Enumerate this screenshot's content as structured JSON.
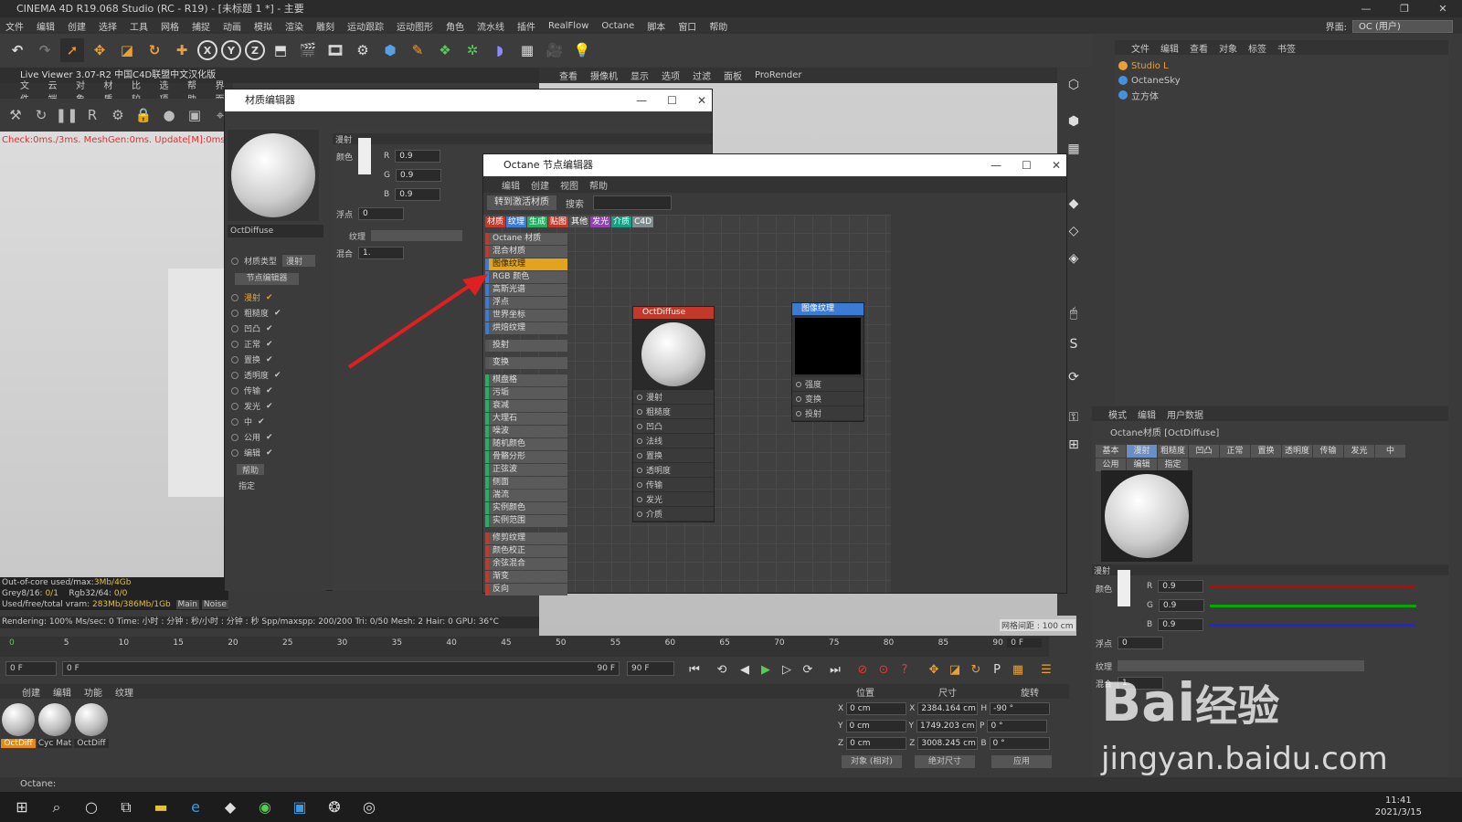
{
  "app": {
    "title": "CINEMA 4D R19.068 Studio (RC - R19) - [未标题 1 *] - 主要",
    "controls": [
      "—",
      "❐",
      "✕"
    ],
    "interface_label": "界面:",
    "interface_value": "OC (用户)"
  },
  "menu": [
    "文件",
    "编辑",
    "创建",
    "选择",
    "工具",
    "网格",
    "捕捉",
    "动画",
    "模拟",
    "渲染",
    "雕刻",
    "运动跟踪",
    "运动图形",
    "角色",
    "流水线",
    "插件",
    "RealFlow",
    "Octane",
    "脚本",
    "窗口",
    "帮助"
  ],
  "live_viewer": {
    "title": "Live Viewer 3.07-R2 中国C4D联盟中文汉化版",
    "menu": [
      "文件",
      "云端",
      "对象",
      "材质",
      "比较",
      "选项",
      "帮助",
      "界面"
    ],
    "status": "Check:0ms./3ms. MeshGen:0ms. Update[M]:0ms. Mesh:1",
    "stats": [
      [
        "Out-of-core used/max:",
        "3Mb/4Gb"
      ],
      [
        "Grey8/16: ",
        "0/1",
        "Rgb32/64: ",
        "0/0"
      ],
      [
        "Used/free/total vram: ",
        "283Mb/386Mb/1Gb"
      ]
    ],
    "stat_tabs": [
      "Main",
      "Noise"
    ],
    "render_line": "Rendering: 100%   Ms/sec: 0   Time: 小时 : 分钟 : 秒/小时 : 分钟 : 秒   Spp/maxspp: 200/200   Tri: 0/50   Mesh: 2   Hair: 0   GPU:  36°C"
  },
  "viewport": {
    "menu": [
      "查看",
      "摄像机",
      "显示",
      "选项",
      "过滤",
      "面板",
      "ProRender"
    ],
    "grid_label": "网格间距 : 100 cm"
  },
  "timeline": {
    "numbers": [
      "0",
      "5",
      "10",
      "15",
      "20",
      "25",
      "30",
      "35",
      "40",
      "45",
      "50",
      "55",
      "60",
      "65",
      "70",
      "75",
      "80",
      "85",
      "90"
    ],
    "end_field": "0 F",
    "start": "0 F",
    "range_start": "0 F",
    "range_end": "90 F",
    "end": "90 F"
  },
  "materials": {
    "menu": [
      "创建",
      "编辑",
      "功能",
      "纹理"
    ],
    "items": [
      "OctDiff",
      "Cyc Mat",
      "OctDiff"
    ]
  },
  "status_bar": "Octane:",
  "object_manager": {
    "menu": [
      "文件",
      "编辑",
      "查看",
      "对象",
      "标签",
      "书签"
    ],
    "objects": [
      {
        "name": "Studio L",
        "color": "#e8a13a"
      },
      {
        "name": "OctaneSky",
        "color": "#4a90d9"
      },
      {
        "name": "立方体",
        "color": "#4a90d9"
      }
    ]
  },
  "attribute_manager": {
    "menu": [
      "模式",
      "编辑",
      "用户数据"
    ],
    "title": "Octane材质 [OctDiffuse]",
    "tabs": [
      "基本",
      "漫射",
      "粗糙度",
      "凹凸",
      "正常",
      "置换",
      "透明度",
      "传输",
      "发光",
      "中",
      "公用",
      "编辑",
      "指定"
    ],
    "active_tab": "漫射",
    "section": "漫射",
    "color_label": "颜色",
    "r": "0.9",
    "g": "0.9",
    "b": "0.9",
    "float_label": "浮点",
    "float": "0",
    "texture_label": "纹理",
    "mix_label": "混合",
    "mix": "1."
  },
  "coordinates": {
    "headers": [
      "位置",
      "尺寸",
      "旋转"
    ],
    "rows": [
      [
        "X",
        "0 cm",
        "X",
        "2384.164 cm",
        "H",
        "-90 °"
      ],
      [
        "Y",
        "0 cm",
        "Y",
        "1749.203 cm",
        "P",
        "0 °"
      ],
      [
        "Z",
        "0 cm",
        "Z",
        "3008.245 cm",
        "B",
        "0 °"
      ]
    ],
    "mode1": "对象 (相对)",
    "mode2": "绝对尺寸",
    "apply": "应用"
  },
  "material_editor": {
    "title": "材质编辑器",
    "name": "OctDiffuse",
    "type_label": "材质类型",
    "type_value": "漫射",
    "node_btn": "节点编辑器",
    "channels": [
      "漫射",
      "粗糙度",
      "凹凸",
      "正常",
      "置换",
      "透明度",
      "传输",
      "发光",
      "中",
      "公用",
      "编辑"
    ],
    "help": "帮助",
    "assign": "指定",
    "section": "漫射",
    "color_label": "颜色",
    "r": "0.9",
    "g": "0.9",
    "b": "0.9",
    "float_label": "浮点",
    "float": "0",
    "texture_label": "纹理",
    "mix_label": "混合",
    "mix": "1."
  },
  "node_editor": {
    "title": "Octane 节点编辑器",
    "menu": [
      "编辑",
      "创建",
      "视图",
      "帮助"
    ],
    "convert_btn": "转到激活材质",
    "search_label": "搜索",
    "categories": [
      {
        "label": "材质",
        "color": "#c0392b"
      },
      {
        "label": "纹理",
        "color": "#3a7bd5"
      },
      {
        "label": "生成",
        "color": "#27ae60"
      },
      {
        "label": "贴图",
        "color": "#c0392b"
      },
      {
        "label": "其他",
        "color": "#555"
      },
      {
        "label": "发光",
        "color": "#8e44ad"
      },
      {
        "label": "介质",
        "color": "#16a085"
      },
      {
        "label": "C4D",
        "color": "#7f8c8d"
      }
    ],
    "list": [
      {
        "t": "Octane 材质",
        "c": "#c0392b"
      },
      {
        "t": "混合材质",
        "c": "#c0392b"
      },
      {
        "t": "图像纹理",
        "c": "#3a7bd5",
        "sel": true
      },
      {
        "t": "RGB 颜色",
        "c": "#3a7bd5"
      },
      {
        "t": "高斯光谱",
        "c": "#3a7bd5"
      },
      {
        "t": "浮点",
        "c": "#3a7bd5"
      },
      {
        "t": "世界坐标",
        "c": "#3a7bd5"
      },
      {
        "t": "烘焙纹理",
        "c": "#3a7bd5"
      },
      {
        "gap": true
      },
      {
        "t": "投射",
        "c": "#555"
      },
      {
        "gap": true
      },
      {
        "t": "变换",
        "c": "#555"
      },
      {
        "gap": true
      },
      {
        "t": "棋盘格",
        "c": "#27ae60"
      },
      {
        "t": "污垢",
        "c": "#27ae60"
      },
      {
        "t": "衰减",
        "c": "#27ae60"
      },
      {
        "t": "大理石",
        "c": "#27ae60"
      },
      {
        "t": "噪波",
        "c": "#27ae60"
      },
      {
        "t": "随机颜色",
        "c": "#27ae60"
      },
      {
        "t": "骨骼分形",
        "c": "#27ae60"
      },
      {
        "t": "正弦波",
        "c": "#27ae60"
      },
      {
        "t": "侧面",
        "c": "#27ae60"
      },
      {
        "t": "湍流",
        "c": "#27ae60"
      },
      {
        "t": "实例颜色",
        "c": "#27ae60"
      },
      {
        "t": "实例范围",
        "c": "#27ae60"
      },
      {
        "gap": true
      },
      {
        "t": "修剪纹理",
        "c": "#c0392b"
      },
      {
        "t": "颜色校正",
        "c": "#c0392b"
      },
      {
        "t": "余弦混合",
        "c": "#c0392b"
      },
      {
        "t": "渐变",
        "c": "#c0392b"
      },
      {
        "t": "反向",
        "c": "#c0392b"
      }
    ],
    "node1": {
      "title": "OctDiffuse",
      "pins": [
        "漫射",
        "粗糙度",
        "凹凸",
        "法线",
        "置换",
        "透明度",
        "传输",
        "发光",
        "介质"
      ]
    },
    "node2": {
      "title": "图像纹理",
      "pins": [
        "强度",
        "变换",
        "投射"
      ]
    }
  },
  "watermark": {
    "brand": "Bai",
    "suffix": "经验",
    "url": "jingyan.baidu.com"
  },
  "clock": {
    "time": "11:41",
    "date": "2021/3/15"
  },
  "colors": {
    "accent": "#e38a1a",
    "red": "#e03030"
  }
}
